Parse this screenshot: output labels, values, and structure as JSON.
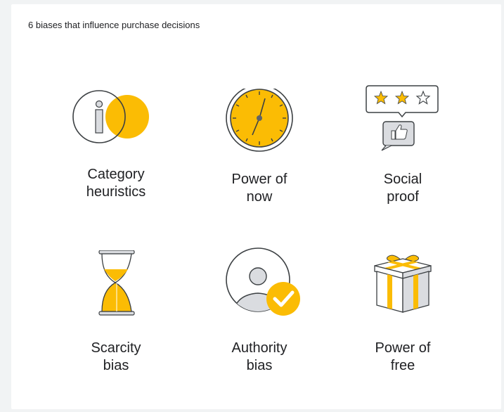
{
  "title": "6 biases that influence purchase decisions",
  "colors": {
    "accent": "#fbbc04",
    "stroke": "#3c4043",
    "grey": "#dadce0",
    "grey_dark": "#9aa0a6",
    "text": "#202124"
  },
  "biases": [
    {
      "line1": "Category",
      "line2": "heuristics",
      "icon": "info-circle-icon"
    },
    {
      "line1": "Power of",
      "line2": "now",
      "icon": "clock-icon"
    },
    {
      "line1": "Social",
      "line2": "proof",
      "icon": "star-rating-thumbs-up-icon"
    },
    {
      "line1": "Scarcity",
      "line2": "bias",
      "icon": "hourglass-icon"
    },
    {
      "line1": "Authority",
      "line2": "bias",
      "icon": "verified-person-icon"
    },
    {
      "line1": "Power of",
      "line2": "free",
      "icon": "gift-box-icon"
    }
  ]
}
